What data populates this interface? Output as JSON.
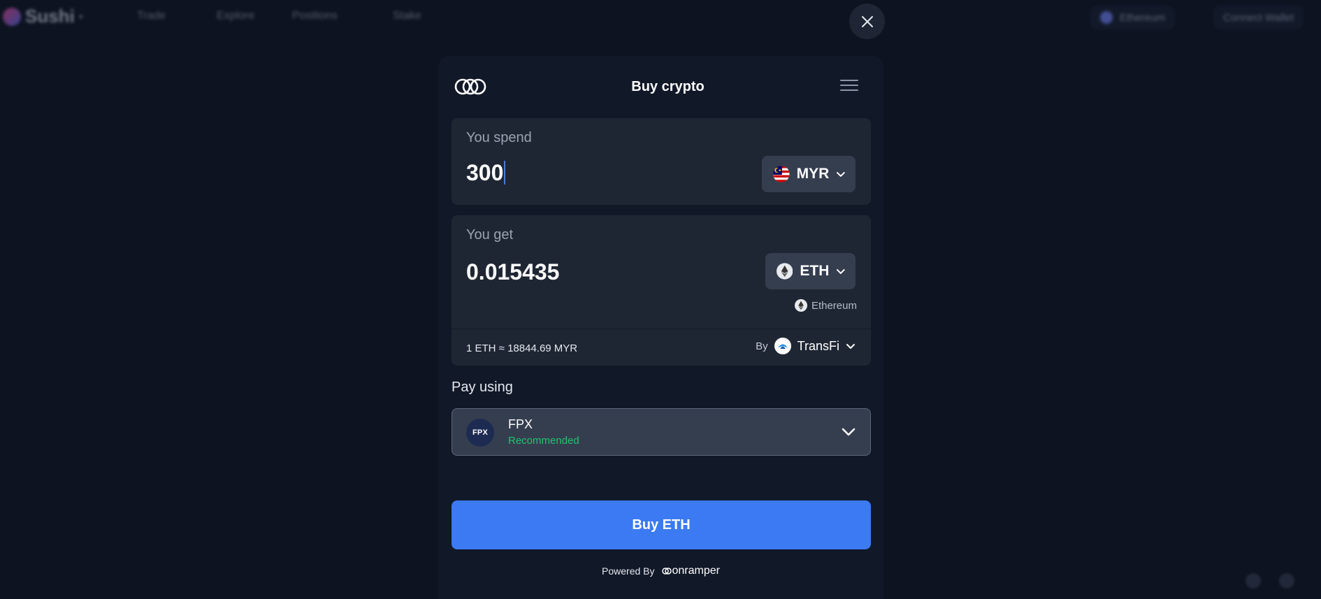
{
  "background_nav": {
    "logo_text": "Sushi",
    "items": [
      "Trade",
      "Explore",
      "Positions",
      "Stake"
    ],
    "chain_label": "Ethereum",
    "connect_label": "Connect Wallet"
  },
  "modal": {
    "title": "Buy crypto",
    "spend": {
      "label": "You spend",
      "amount": "300",
      "currency": "MYR",
      "currency_icon": "malaysia-flag-icon"
    },
    "get": {
      "label": "You get",
      "amount": "0.015435",
      "token": "ETH",
      "token_icon": "ethereum-icon",
      "network": "Ethereum"
    },
    "rate": "1 ETH ≈ 18844.69 MYR",
    "provider": {
      "by_label": "By",
      "name": "TransFi"
    },
    "pay": {
      "label": "Pay using",
      "method": "FPX",
      "method_logo_text": "FPX",
      "badge": "Recommended"
    },
    "buy_button": "Buy ETH",
    "powered_by_label": "Powered By",
    "powered_by_brand": "onramper"
  },
  "colors": {
    "background": "#0d1320",
    "card": "#1f2633",
    "accent": "#3b7af2",
    "recommended": "#1ec46e"
  }
}
